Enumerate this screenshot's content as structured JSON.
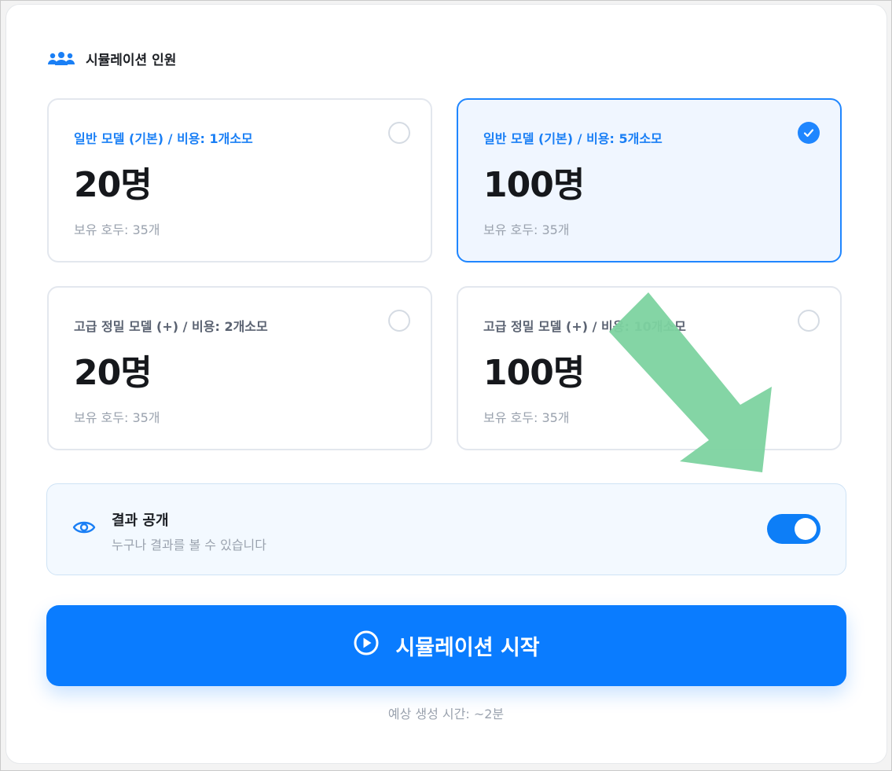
{
  "section": {
    "title": "시뮬레이션 인원",
    "icon": "users-icon"
  },
  "options": [
    {
      "cost": "일반 모델 (기본) / 비용: 1개소모",
      "count": "20명",
      "balance": "보유 호두: 35개",
      "selected": false
    },
    {
      "cost": "일반 모델 (기본) / 비용: 5개소모",
      "count": "100명",
      "balance": "보유 호두: 35개",
      "selected": true
    },
    {
      "cost": "고급 정밀 모델 (+) / 비용: 2개소모",
      "count": "20명",
      "balance": "보유 호두: 35개",
      "selected": false
    },
    {
      "cost": "고급 정밀 모델 (+) / 비용: 10개소모",
      "count": "100명",
      "balance": "보유 호두: 35개",
      "selected": false
    }
  ],
  "public_setting": {
    "title": "결과 공개",
    "description": "누구나 결과를 볼 수 있습니다",
    "enabled": true,
    "icon": "eye-icon"
  },
  "start_button": {
    "label": "시뮬레이션 시작",
    "icon": "play-circle-icon"
  },
  "estimate": "예상 생성 시간: ~2분",
  "colors": {
    "accent": "#0a7cff",
    "annotation_arrow": "#7dd3a0"
  }
}
